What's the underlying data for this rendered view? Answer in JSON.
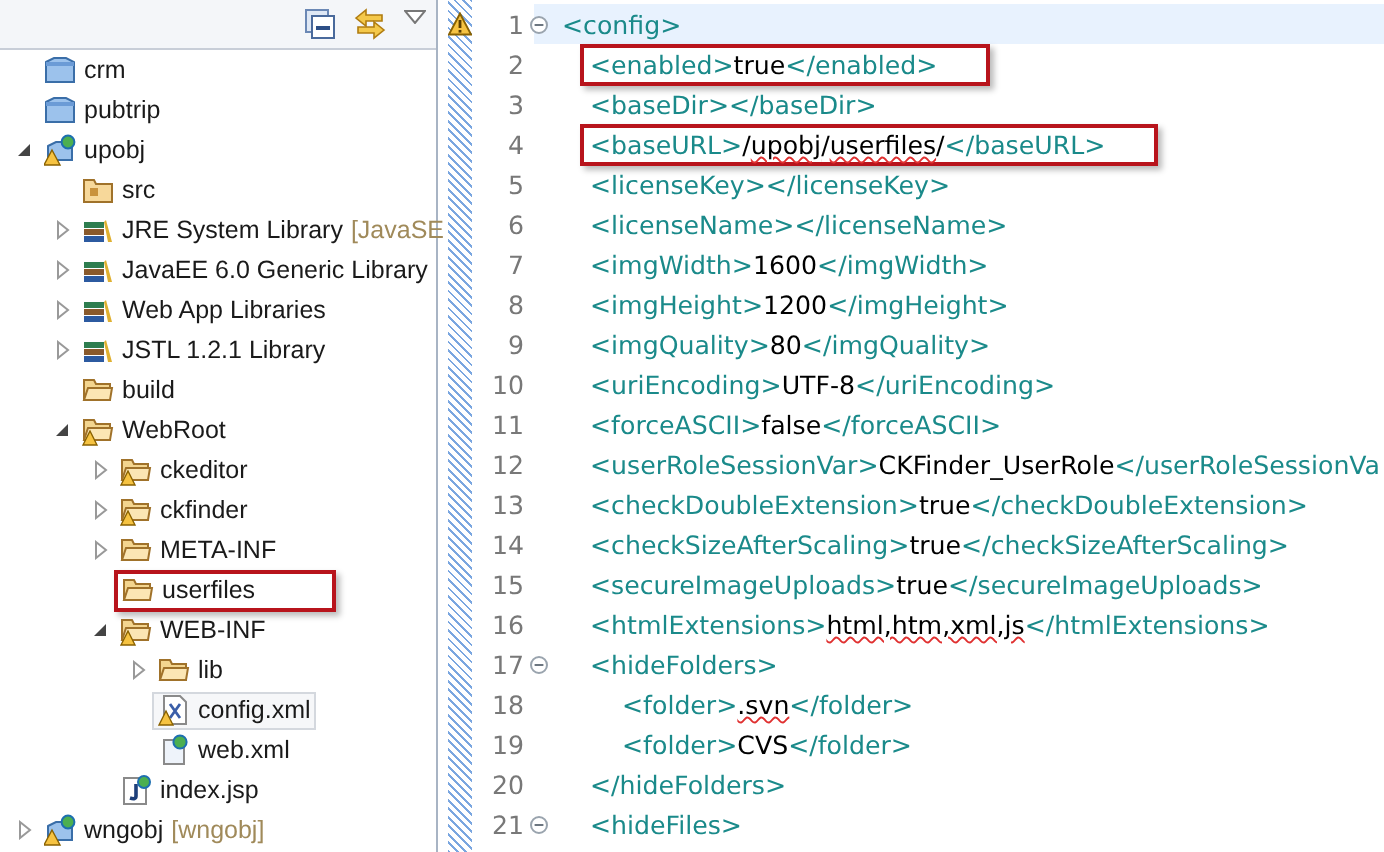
{
  "tree": {
    "items": [
      {
        "label": "crm",
        "kind": "project",
        "selected": false,
        "highlighted": false
      },
      {
        "label": "pubtrip",
        "kind": "project",
        "selected": false,
        "highlighted": false
      },
      {
        "label": "upobj",
        "kind": "web-project",
        "warning": true,
        "expanded": true,
        "selected": false,
        "highlighted": false,
        "children": [
          {
            "label": "src",
            "kind": "source-folder",
            "selected": false,
            "highlighted": false
          },
          {
            "label": "JRE System Library",
            "decoration": "[JavaSE",
            "kind": "library",
            "expanded": false,
            "selected": false,
            "highlighted": false
          },
          {
            "label": "JavaEE 6.0 Generic Library",
            "kind": "library",
            "expanded": false,
            "selected": false,
            "highlighted": false
          },
          {
            "label": "Web App Libraries",
            "kind": "library",
            "expanded": false,
            "selected": false,
            "highlighted": false
          },
          {
            "label": "JSTL 1.2.1 Library",
            "kind": "library",
            "expanded": false,
            "selected": false,
            "highlighted": false
          },
          {
            "label": "build",
            "kind": "folder",
            "selected": false,
            "highlighted": false
          },
          {
            "label": "WebRoot",
            "kind": "folder",
            "warning": true,
            "expanded": true,
            "selected": false,
            "highlighted": false,
            "children": [
              {
                "label": "ckeditor",
                "kind": "folder",
                "warning": true,
                "expanded": false,
                "selected": false,
                "highlighted": false
              },
              {
                "label": "ckfinder",
                "kind": "folder",
                "warning": true,
                "expanded": false,
                "selected": false,
                "highlighted": false
              },
              {
                "label": "META-INF",
                "kind": "folder",
                "expanded": false,
                "selected": false,
                "highlighted": false
              },
              {
                "label": "userfiles",
                "kind": "folder",
                "selected": false,
                "highlighted": true
              },
              {
                "label": "WEB-INF",
                "kind": "folder",
                "warning": true,
                "expanded": true,
                "selected": false,
                "highlighted": false,
                "children": [
                  {
                    "label": "lib",
                    "kind": "folder",
                    "expanded": false,
                    "selected": false,
                    "highlighted": false
                  },
                  {
                    "label": "config.xml",
                    "kind": "xml-file",
                    "warning": true,
                    "selected": true,
                    "highlighted": false
                  },
                  {
                    "label": "web.xml",
                    "kind": "web-xml-file",
                    "selected": false,
                    "highlighted": false
                  }
                ]
              },
              {
                "label": "index.jsp",
                "kind": "jsp-file",
                "selected": false,
                "highlighted": false
              }
            ]
          }
        ]
      },
      {
        "label": "wngobj",
        "decoration": "[wngobj]",
        "kind": "web-project",
        "warning": true,
        "expanded": false,
        "selected": false,
        "highlighted": false
      }
    ]
  },
  "editor": {
    "lines": [
      {
        "number": "1",
        "kind": "root",
        "warning": true,
        "foldable": true,
        "current": true,
        "highlighted": false,
        "segments": [
          {
            "kind": "tag",
            "text": "<config>"
          }
        ]
      },
      {
        "number": "2",
        "kind": "child",
        "highlighted": true,
        "segments": [
          {
            "kind": "tag",
            "text": "<enabled>"
          },
          {
            "kind": "text",
            "text": "true"
          },
          {
            "kind": "tag",
            "text": "</enabled>"
          }
        ]
      },
      {
        "number": "3",
        "kind": "child",
        "highlighted": false,
        "segments": [
          {
            "kind": "tag",
            "text": "<baseDir></baseDir>"
          }
        ]
      },
      {
        "number": "4",
        "kind": "child",
        "highlighted": true,
        "segments": [
          {
            "kind": "tag",
            "text": "<baseURL>"
          },
          {
            "kind": "text",
            "text": "/"
          },
          {
            "kind": "text",
            "text": "upobj",
            "misspelled": true
          },
          {
            "kind": "text",
            "text": "/"
          },
          {
            "kind": "text",
            "text": "userfiles",
            "misspelled": true
          },
          {
            "kind": "text",
            "text": "/"
          },
          {
            "kind": "tag",
            "text": "</baseURL>"
          }
        ]
      },
      {
        "number": "5",
        "kind": "child",
        "highlighted": false,
        "segments": [
          {
            "kind": "tag",
            "text": "<licenseKey></licenseKey>"
          }
        ]
      },
      {
        "number": "6",
        "kind": "child",
        "highlighted": false,
        "segments": [
          {
            "kind": "tag",
            "text": "<licenseName></licenseName>"
          }
        ]
      },
      {
        "number": "7",
        "kind": "child",
        "highlighted": false,
        "segments": [
          {
            "kind": "tag",
            "text": "<imgWidth>"
          },
          {
            "kind": "text",
            "text": "1600"
          },
          {
            "kind": "tag",
            "text": "</imgWidth>"
          }
        ]
      },
      {
        "number": "8",
        "kind": "child",
        "highlighted": false,
        "segments": [
          {
            "kind": "tag",
            "text": "<imgHeight>"
          },
          {
            "kind": "text",
            "text": "1200"
          },
          {
            "kind": "tag",
            "text": "</imgHeight>"
          }
        ]
      },
      {
        "number": "9",
        "kind": "child",
        "highlighted": false,
        "segments": [
          {
            "kind": "tag",
            "text": "<imgQuality>"
          },
          {
            "kind": "text",
            "text": "80"
          },
          {
            "kind": "tag",
            "text": "</imgQuality>"
          }
        ]
      },
      {
        "number": "10",
        "kind": "child",
        "highlighted": false,
        "segments": [
          {
            "kind": "tag",
            "text": "<uriEncoding>"
          },
          {
            "kind": "text",
            "text": "UTF-8"
          },
          {
            "kind": "tag",
            "text": "</uriEncoding>"
          }
        ]
      },
      {
        "number": "11",
        "kind": "child",
        "highlighted": false,
        "segments": [
          {
            "kind": "tag",
            "text": "<forceASCII>"
          },
          {
            "kind": "text",
            "text": "false"
          },
          {
            "kind": "tag",
            "text": "</forceASCII>"
          }
        ]
      },
      {
        "number": "12",
        "kind": "child",
        "highlighted": false,
        "segments": [
          {
            "kind": "tag",
            "text": "<userRoleSessionVar>"
          },
          {
            "kind": "text",
            "text": "CKFinder_UserRole"
          },
          {
            "kind": "tag",
            "text": "</userRoleSessionVa"
          }
        ]
      },
      {
        "number": "13",
        "kind": "child",
        "highlighted": false,
        "segments": [
          {
            "kind": "tag",
            "text": "<checkDoubleExtension>"
          },
          {
            "kind": "text",
            "text": "true"
          },
          {
            "kind": "tag",
            "text": "</checkDoubleExtension>"
          }
        ]
      },
      {
        "number": "14",
        "kind": "child",
        "highlighted": false,
        "segments": [
          {
            "kind": "tag",
            "text": "<checkSizeAfterScaling>"
          },
          {
            "kind": "text",
            "text": "true"
          },
          {
            "kind": "tag",
            "text": "</checkSizeAfterScaling>"
          }
        ]
      },
      {
        "number": "15",
        "kind": "child",
        "highlighted": false,
        "segments": [
          {
            "kind": "tag",
            "text": "<secureImageUploads>"
          },
          {
            "kind": "text",
            "text": "true"
          },
          {
            "kind": "tag",
            "text": "</secureImageUploads>"
          }
        ]
      },
      {
        "number": "16",
        "kind": "child",
        "highlighted": false,
        "segments": [
          {
            "kind": "tag",
            "text": "<htmlExtensions>"
          },
          {
            "kind": "text",
            "text": "html,htm,xml,js",
            "misspelled": true
          },
          {
            "kind": "tag",
            "text": "</htmlExtensions>"
          }
        ]
      },
      {
        "number": "17",
        "kind": "child",
        "foldable": true,
        "highlighted": false,
        "segments": [
          {
            "kind": "tag",
            "text": "<hideFolders>"
          }
        ]
      },
      {
        "number": "18",
        "kind": "grandchild",
        "highlighted": false,
        "segments": [
          {
            "kind": "tag",
            "text": "<folder>"
          },
          {
            "kind": "text",
            "text": ".svn",
            "misspelled": true
          },
          {
            "kind": "tag",
            "text": "</folder>"
          }
        ]
      },
      {
        "number": "19",
        "kind": "grandchild",
        "highlighted": false,
        "segments": [
          {
            "kind": "tag",
            "text": "<folder>"
          },
          {
            "kind": "text",
            "text": "CVS"
          },
          {
            "kind": "tag",
            "text": "</folder>"
          }
        ]
      },
      {
        "number": "20",
        "kind": "child",
        "highlighted": false,
        "segments": [
          {
            "kind": "tag",
            "text": "</hideFolders>"
          }
        ]
      },
      {
        "number": "21",
        "kind": "child",
        "foldable": true,
        "highlighted": false,
        "segments": [
          {
            "kind": "tag",
            "text": "<hideFiles>"
          }
        ]
      }
    ]
  }
}
